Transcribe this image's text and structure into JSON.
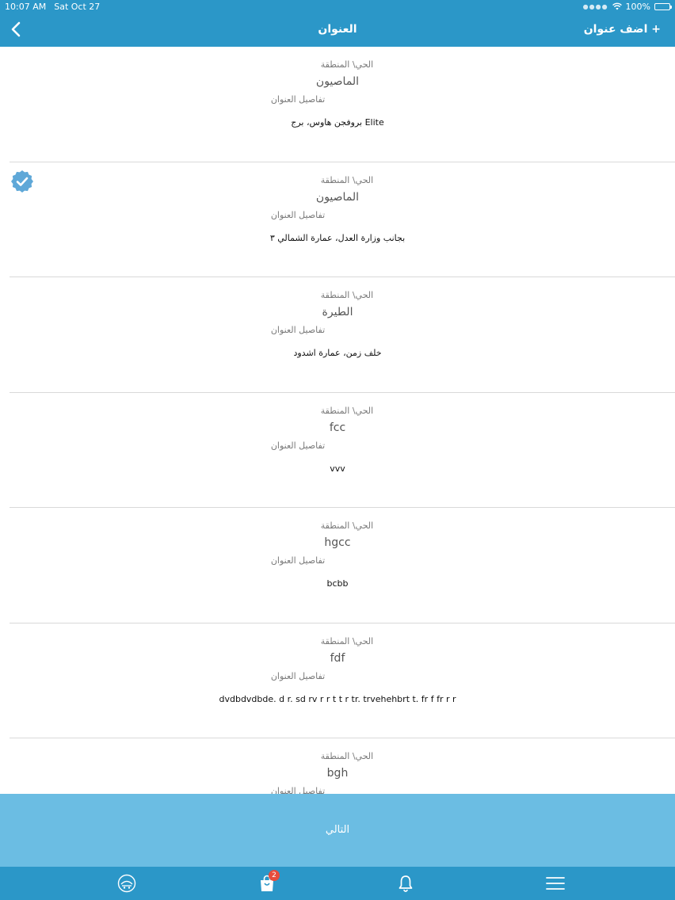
{
  "status_bar": {
    "time": "10:07 AM",
    "date": "Sat Oct 27",
    "battery": "100%"
  },
  "nav": {
    "title": "العنوان",
    "add_address": "+ اضف عنوان"
  },
  "labels": {
    "region": "الحي\\ المنطقة",
    "details": "تفاصيل العنوان"
  },
  "addresses": [
    {
      "region": "الماصيون",
      "details": "بروفجن هاوس، برج Elite",
      "selected": false
    },
    {
      "region": "الماصيون",
      "details": "بجانب وزارة العدل، عمارة الشمالي ٣",
      "selected": true
    },
    {
      "region": "الطيرة",
      "details": "خلف زمن، عمارة اشدود",
      "selected": false
    },
    {
      "region": "fcc",
      "details": "vvv",
      "selected": false
    },
    {
      "region": "hgcc",
      "details": "bcbb",
      "selected": false
    },
    {
      "region": "fdf",
      "details": "dvdbdvdbde. d r. sd rv r r t t r tr. trvehehbrt t. fr f fr r r",
      "selected": false
    },
    {
      "region": "bgh",
      "details": "",
      "selected": false
    }
  ],
  "next_button": {
    "label": "التالي"
  },
  "tab_bar": {
    "cart_badge": "2"
  },
  "colors": {
    "primary": "#2b97c8",
    "next_button": "#6bbde3",
    "verified": "#5fa8d8",
    "badge": "#e74c3c"
  }
}
